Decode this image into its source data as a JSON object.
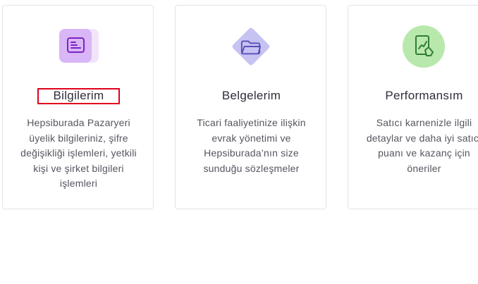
{
  "cards": [
    {
      "icon": "profile-document-icon",
      "title": "Bilgilerim",
      "description": "Hepsiburada Pazaryeri üyelik bilgileriniz, şifre değişikliği işlemleri, yetkili kişi ve şirket bilgileri işlemleri"
    },
    {
      "icon": "folder-icon",
      "title": "Belgelerim",
      "description": "Ticari faaliyetinize ilişkin evrak yönetimi ve Hepsiburada’nın size sunduğu sözleşmeler"
    },
    {
      "icon": "performance-chart-icon",
      "title": "Performansım",
      "description": "Satıcı karnenizle ilgili detaylar ve daha iyi satıcı puanı ve kazanç için öneriler"
    }
  ],
  "colors": {
    "card1_accent": "#8a2be2",
    "card2_accent": "#6a5acd",
    "card3_accent": "#4caf50",
    "highlight_border": "#e0001b"
  }
}
